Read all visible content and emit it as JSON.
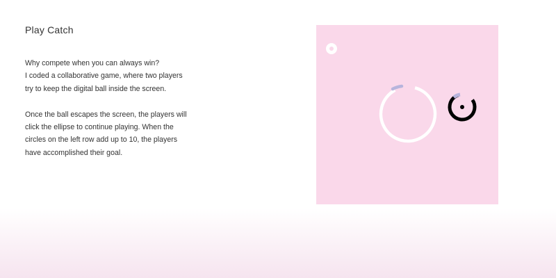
{
  "page": {
    "title": "Play Catch",
    "description": {
      "paragraph1": [
        "Why compete when you can always win?",
        "I coded a collaborative game, where two players",
        "try to keep the digital ball inside the screen."
      ],
      "paragraph2": [
        "Once the ball escapes the screen, the players will",
        "click the ellipse to continue playing. When the",
        "circles on the left row add up to 10, the players",
        "have accomplished their goal."
      ]
    }
  },
  "game": {
    "score_circles_shown": 1,
    "colors": {
      "background": "#fad8ea",
      "ring": "#ffffff",
      "ring_highlight": "#b7b4dc",
      "ball": "#000000",
      "score_dot": "#fad8ea"
    }
  }
}
